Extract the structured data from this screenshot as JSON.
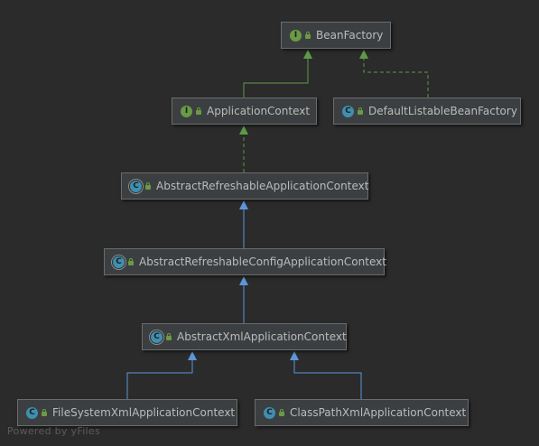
{
  "diagram": {
    "nodes": [
      {
        "id": "bf",
        "label": "BeanFactory",
        "kind": "interface",
        "kind_letter": "I"
      },
      {
        "id": "ac",
        "label": "ApplicationContext",
        "kind": "interface",
        "kind_letter": "I"
      },
      {
        "id": "dlbf",
        "label": "DefaultListableBeanFactory",
        "kind": "class",
        "kind_letter": "C"
      },
      {
        "id": "arac",
        "label": "AbstractRefreshableApplicationContext",
        "kind": "abstract",
        "kind_letter": "C"
      },
      {
        "id": "arcac",
        "label": "AbstractRefreshableConfigApplicationContext",
        "kind": "abstract",
        "kind_letter": "C"
      },
      {
        "id": "axac",
        "label": "AbstractXmlApplicationContext",
        "kind": "abstract",
        "kind_letter": "C"
      },
      {
        "id": "fsxac",
        "label": "FileSystemXmlApplicationContext",
        "kind": "class",
        "kind_letter": "C"
      },
      {
        "id": "cpxac",
        "label": "ClassPathXmlApplicationContext",
        "kind": "class",
        "kind_letter": "C"
      }
    ],
    "edges": [
      {
        "from": "ac",
        "to": "bf",
        "type": "extends-interface"
      },
      {
        "from": "dlbf",
        "to": "bf",
        "type": "implements"
      },
      {
        "from": "arac",
        "to": "ac",
        "type": "implements"
      },
      {
        "from": "arcac",
        "to": "arac",
        "type": "extends"
      },
      {
        "from": "axac",
        "to": "arcac",
        "type": "extends"
      },
      {
        "from": "fsxac",
        "to": "axac",
        "type": "extends"
      },
      {
        "from": "cpxac",
        "to": "axac",
        "type": "extends"
      }
    ]
  },
  "colors": {
    "background": "#2b2b2b",
    "interface_edge": "#5f9a47",
    "class_edge": "#5e95d8",
    "node_fill": "#3c3f41",
    "node_text": "#bbbbbb"
  },
  "footer": "Powered by yFiles"
}
